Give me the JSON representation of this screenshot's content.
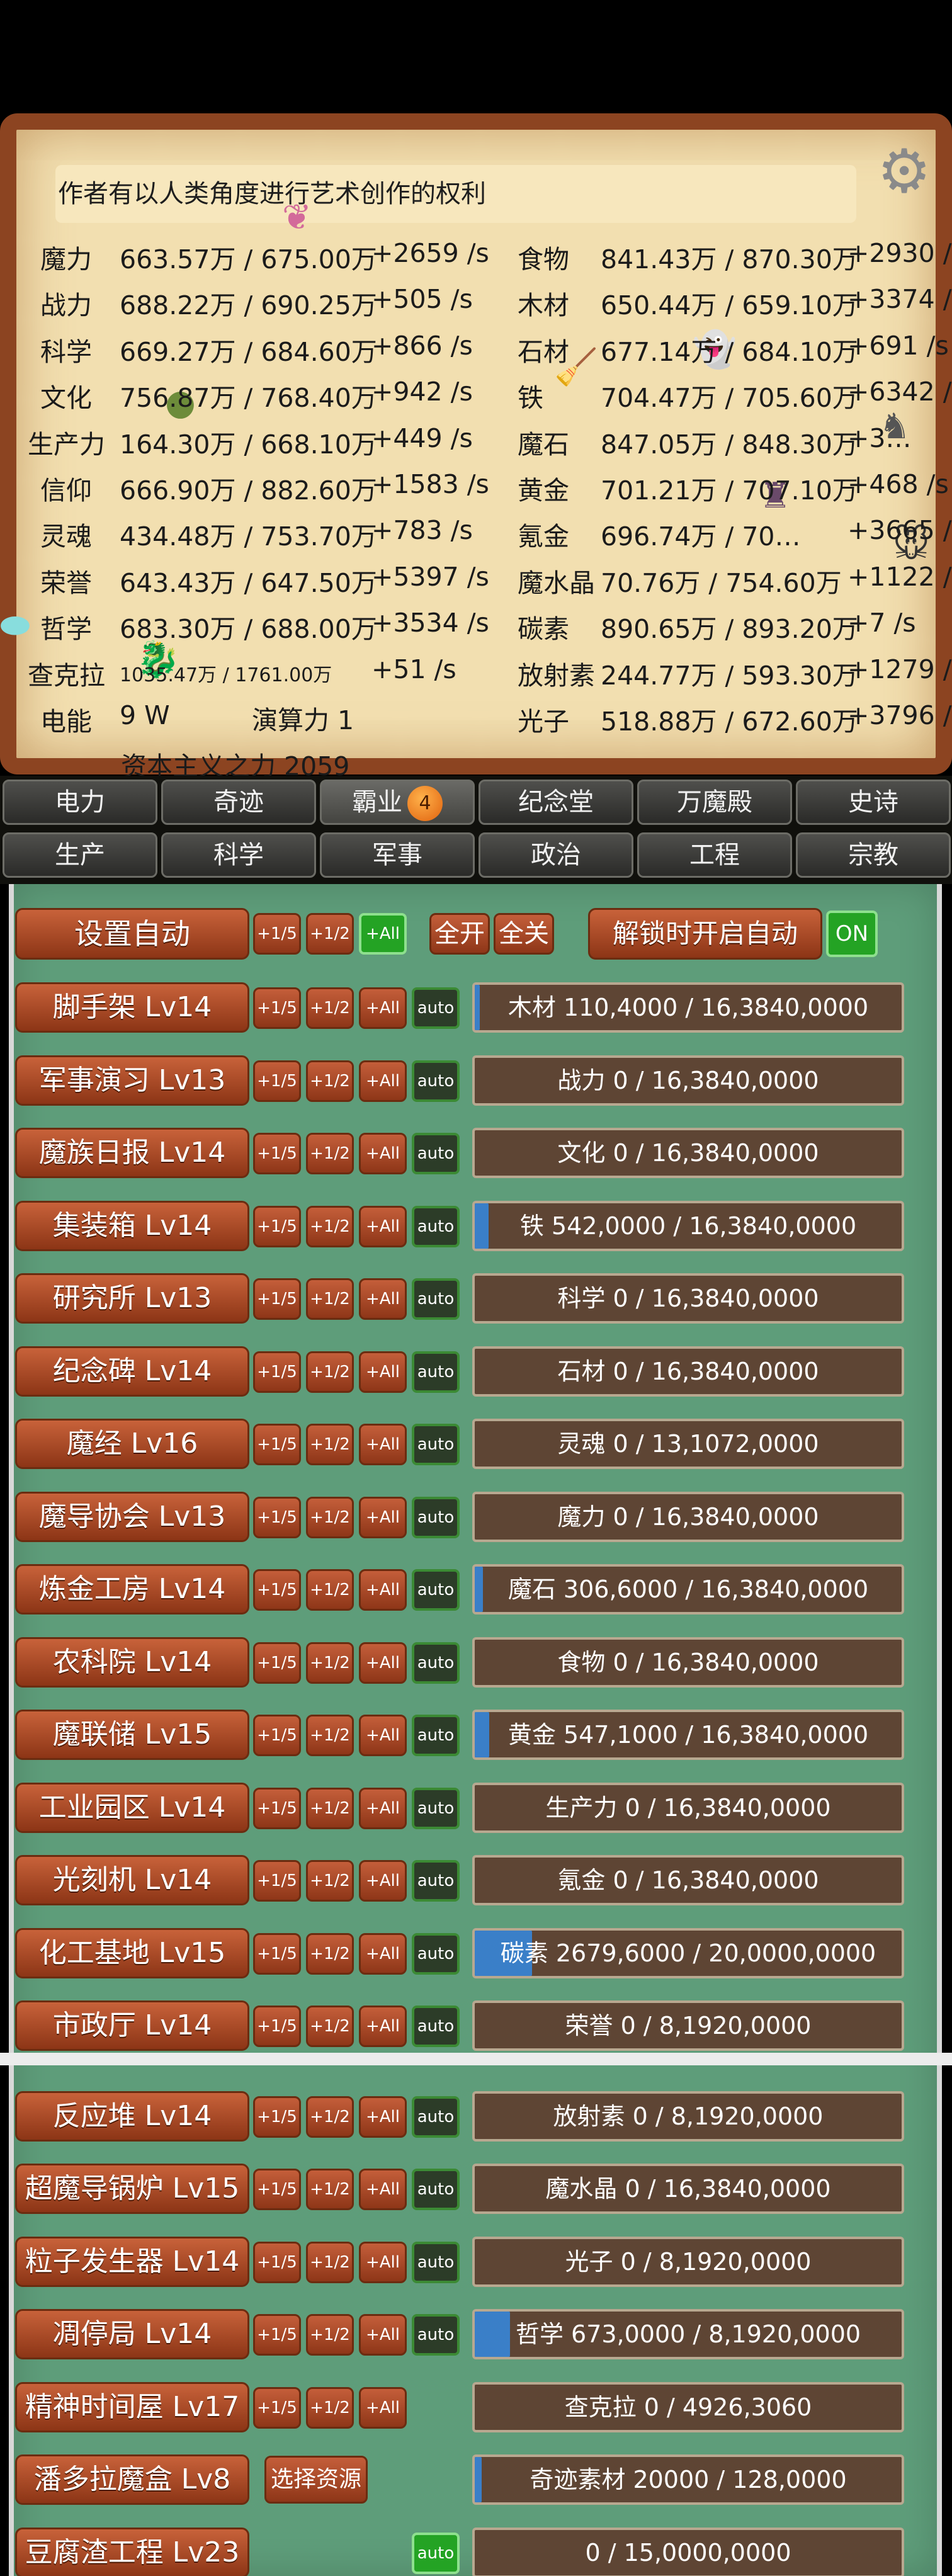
{
  "notice": "作者有以人类角度进行艺术创作的权利",
  "resources_left": [
    {
      "name": "魔力",
      "amount": "663.57万 / 675.00万",
      "rate": "+2659 /s"
    },
    {
      "name": "战力",
      "amount": "688.22万 / 690.25万",
      "rate": "+505 /s"
    },
    {
      "name": "科学",
      "amount": "669.27万 / 684.60万",
      "rate": "+866 /s"
    },
    {
      "name": "文化",
      "amount": "756.87万 / 768.40万",
      "rate": "+942 /s"
    },
    {
      "name": "生产力",
      "amount": "164.30万 / 668.10万",
      "rate": "+449 /s"
    },
    {
      "name": "信仰",
      "amount": "666.90万 / 882.60万",
      "rate": "+1583 /s"
    },
    {
      "name": "灵魂",
      "amount": "434.48万 / 753.70万",
      "rate": "+783 /s"
    },
    {
      "name": "荣誉",
      "amount": "643.43万 / 647.50万",
      "rate": "+5397 /s"
    },
    {
      "name": "哲学",
      "amount": "683.30万 / 688.00万",
      "rate": "+3534 /s"
    },
    {
      "name": "查克拉",
      "amount": "1035.47万 / 1761.00万",
      "rate": "+51 /s"
    },
    {
      "name": "电能",
      "amount": "9 W",
      "rate": ""
    }
  ],
  "resources_right": [
    {
      "name": "食物",
      "amount": "841.43万 / 870.30万",
      "rate": "+2930 /s"
    },
    {
      "name": "木材",
      "amount": "650.44万 / 659.10万",
      "rate": "+3374 /s"
    },
    {
      "name": "石材",
      "amount": "677.14万 / 684.10万",
      "rate": "+691 /s"
    },
    {
      "name": "铁",
      "amount": "704.47万 / 705.60万",
      "rate": "+6342 /s"
    },
    {
      "name": "魔石",
      "amount": "847.05万 / 848.30万",
      "rate": "+3…"
    },
    {
      "name": "黄金",
      "amount": "701.21万 / 707.10万",
      "rate": "+468 /s"
    },
    {
      "name": "氪金",
      "amount": "696.74万 / 70…",
      "rate": "+3665 /s"
    },
    {
      "name": "魔水晶",
      "amount": "70.76万 / 754.60万",
      "rate": "+1122 /s"
    },
    {
      "name": "碳素",
      "amount": "890.65万 / 893.20万",
      "rate": "+7 /s"
    },
    {
      "name": "放射素",
      "amount": "244.77万 / 593.30万",
      "rate": "+1279 /s"
    },
    {
      "name": "光子",
      "amount": "518.88万 / 672.60万",
      "rate": "+3796 /s"
    }
  ],
  "compute": "演算力 1",
  "capitalism": "资本主义之力 2059",
  "tabs_row1": [
    "电力",
    "奇迹",
    "霸业",
    "纪念堂",
    "万魔殿",
    "史诗"
  ],
  "tab_badge": "4",
  "tabs_row2": [
    "生产",
    "科学",
    "军事",
    "政治",
    "工程",
    "宗教"
  ],
  "controls": {
    "set_auto": "设置自动",
    "fifth": "+1/5",
    "half": "+1/2",
    "all": "+All",
    "open_all": "全开",
    "close_all": "全关",
    "unlock_auto": "解锁时开启自动",
    "on": "ON",
    "auto": "auto",
    "select_resource": "选择资源"
  },
  "buildings": [
    {
      "name": "脚手架 Lv14",
      "progress": "木材 110,4000 / 16,3840,0000",
      "fill": 0.0067,
      "auto": true
    },
    {
      "name": "军事演习 Lv13",
      "progress": "战力 0 / 16,3840,0000",
      "fill": 0,
      "auto": true
    },
    {
      "name": "魔族日报 Lv14",
      "progress": "文化 0 / 16,3840,0000",
      "fill": 0,
      "auto": true
    },
    {
      "name": "集装箱 Lv14",
      "progress": "铁 542,0000 / 16,3840,0000",
      "fill": 0.033,
      "auto": true
    },
    {
      "name": "研究所 Lv13",
      "progress": "科学 0 / 16,3840,0000",
      "fill": 0,
      "auto": true
    },
    {
      "name": "纪念碑 Lv14",
      "progress": "石材 0 / 16,3840,0000",
      "fill": 0,
      "auto": true
    },
    {
      "name": "魔经 Lv16",
      "progress": "灵魂 0 / 13,1072,0000",
      "fill": 0,
      "auto": true
    },
    {
      "name": "魔导协会 Lv13",
      "progress": "魔力 0 / 16,3840,0000",
      "fill": 0,
      "auto": true
    },
    {
      "name": "炼金工房 Lv14",
      "progress": "魔石 306,6000 / 16,3840,0000",
      "fill": 0.0187,
      "auto": true
    },
    {
      "name": "农科院 Lv14",
      "progress": "食物 0 / 16,3840,0000",
      "fill": 0,
      "auto": true
    },
    {
      "name": "魔联储 Lv15",
      "progress": "黄金 547,1000 / 16,3840,0000",
      "fill": 0.0334,
      "auto": true
    },
    {
      "name": "工业园区 Lv14",
      "progress": "生产力 0 / 16,3840,0000",
      "fill": 0,
      "auto": true
    },
    {
      "name": "光刻机 Lv14",
      "progress": "氪金 0 / 16,3840,0000",
      "fill": 0,
      "auto": true
    },
    {
      "name": "化工基地 Lv15",
      "progress": "碳素 2679,6000 / 20,0000,0000",
      "fill": 0.134,
      "auto": true
    },
    {
      "name": "市政厅 Lv14",
      "progress": "荣誉 0 / 8,1920,0000",
      "fill": 0,
      "auto": true
    },
    {
      "name": "反应堆 Lv14",
      "progress": "放射素 0 / 8,1920,0000",
      "fill": 0,
      "auto": true
    },
    {
      "name": "超魔导锅炉 Lv15",
      "progress": "魔水晶 0 / 16,3840,0000",
      "fill": 0,
      "auto": true
    },
    {
      "name": "粒子发生器 Lv14",
      "progress": "光子 0 / 8,1920,0000",
      "fill": 0,
      "auto": true
    },
    {
      "name": "凋停局 Lv14",
      "progress": "哲学 673,0000 / 8,1920,0000",
      "fill": 0.0821,
      "auto": true
    },
    {
      "name": "精神时间屋 Lv17",
      "progress": "查克拉 0 / 4926,3060",
      "fill": 0,
      "auto": false
    },
    {
      "name": "潘多拉魔盒 Lv8",
      "progress": "奇迹素材 20000 / 128,0000",
      "fill": 0.0156,
      "auto": false
    },
    {
      "name": "豆腐渣工程 Lv23",
      "progress": "0 / 15,0000,0000",
      "fill": 0,
      "auto": true
    }
  ]
}
